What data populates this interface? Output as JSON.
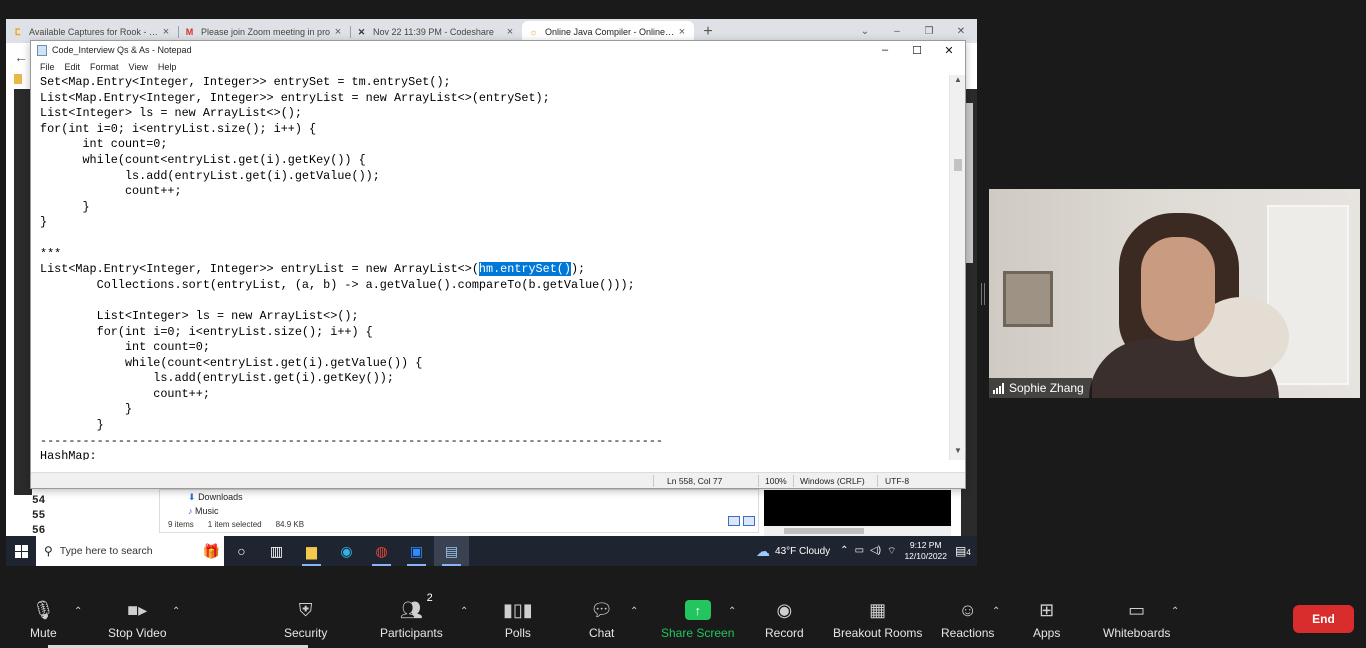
{
  "browser": {
    "tabs": [
      {
        "title": "Available Captures for Rook - Lee",
        "icon": "leetcode-icon",
        "active": false
      },
      {
        "title": "Please join Zoom meeting in pro",
        "icon": "gmail-icon",
        "active": false
      },
      {
        "title": "Nov 22 11:39 PM - Codeshare",
        "icon": "codeshare-icon",
        "active": false
      },
      {
        "title": "Online Java Compiler - Online Ja",
        "icon": "compiler-icon",
        "active": true
      }
    ],
    "new_tab": "+"
  },
  "notepad": {
    "title": "Code_Interview Qs & As - Notepad",
    "menu": [
      "File",
      "Edit",
      "Format",
      "View",
      "Help"
    ],
    "lines": [
      "Set<Map.Entry<Integer, Integer>> entrySet = tm.entrySet();",
      "List<Map.Entry<Integer, Integer>> entryList = new ArrayList<>(entrySet);",
      "List<Integer> ls = new ArrayList<>();",
      "for(int i=0; i<entryList.size(); i++) {",
      "      int count=0;",
      "      while(count<entryList.get(i).getKey()) {",
      "            ls.add(entryList.get(i).getValue());",
      "            count++;",
      "      }",
      "}",
      "",
      "***",
      "",
      "        Collections.sort(entryList, (a, b) -> a.getValue().compareTo(b.getValue()));",
      "",
      "        List<Integer> ls = new ArrayList<>();",
      "        for(int i=0; i<entryList.size(); i++) {",
      "            int count=0;",
      "            while(count<entryList.get(i).getValue()) {",
      "                ls.add(entryList.get(i).getKey());",
      "                count++;",
      "            }",
      "        }",
      "----------------------------------------------------------------------------------------",
      "HashMap:"
    ],
    "highlighted_line": {
      "before": "List<Map.Entry<Integer, Integer>> entryList = new ArrayList<>(",
      "selected": "hm.entrySet()",
      "after": ");"
    },
    "status": {
      "position": "Ln 558, Col 77",
      "zoom": "100%",
      "line_ending": "Windows (CRLF)",
      "encoding": "UTF-8"
    }
  },
  "ide": {
    "line_numbers": [
      "54",
      "55",
      "56"
    ]
  },
  "explorer": {
    "items": [
      "Downloads",
      "Music"
    ],
    "status": {
      "count": "9 items",
      "selected": "1 item selected",
      "size": "84.9 KB"
    }
  },
  "taskbar": {
    "search_placeholder": "Type here to search",
    "weather": "43°F  Cloudy",
    "time": "9:12 PM",
    "date": "12/10/2022",
    "notifications": "4"
  },
  "participant": {
    "name": "Sophie Zhang"
  },
  "zoom_toolbar": {
    "mute": "Mute",
    "stop_video": "Stop Video",
    "security": "Security",
    "participants": "Participants",
    "participants_count": "2",
    "polls": "Polls",
    "chat": "Chat",
    "share_screen": "Share Screen",
    "record": "Record",
    "breakout_rooms": "Breakout Rooms",
    "reactions": "Reactions",
    "apps": "Apps",
    "whiteboards": "Whiteboards",
    "end": "End"
  },
  "colors": {
    "selection": "#0078d7",
    "share_green": "#22c55e",
    "end_red": "#d92d2d"
  }
}
